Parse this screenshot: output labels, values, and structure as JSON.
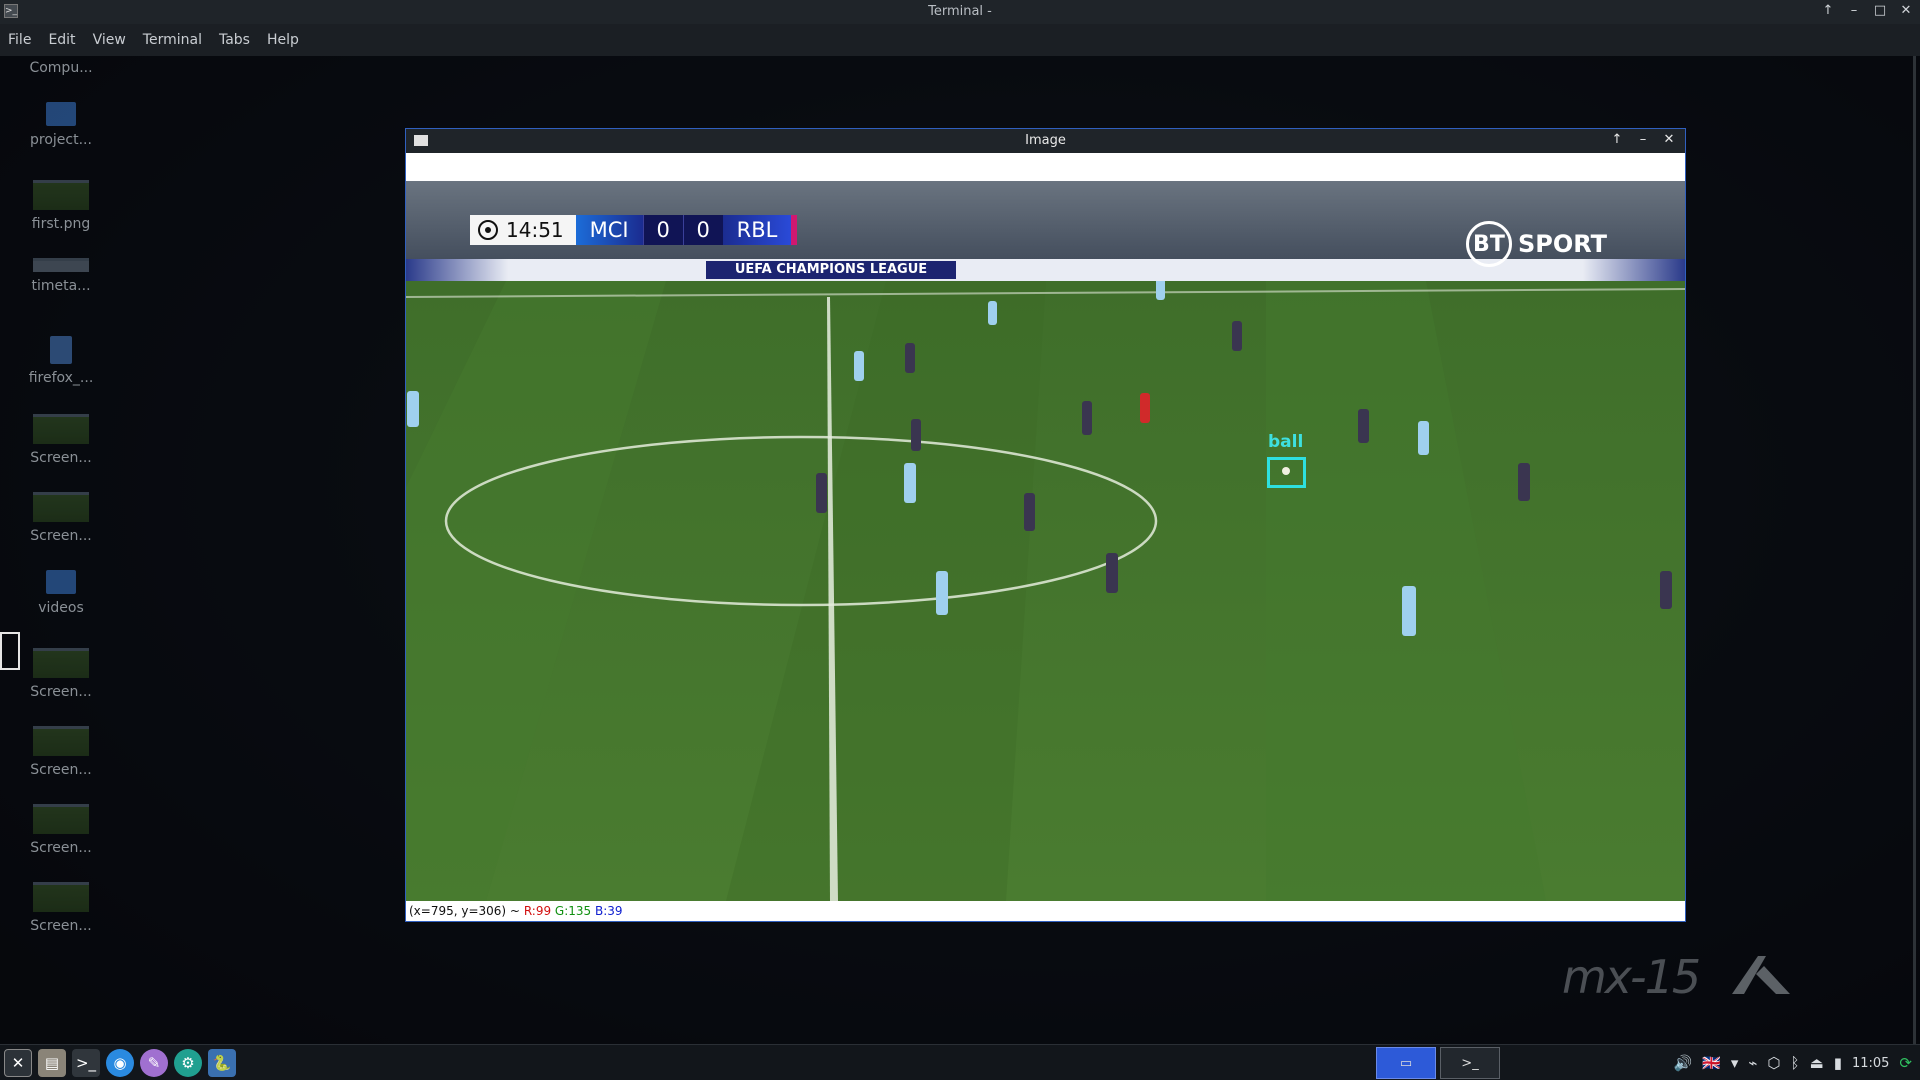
{
  "terminal": {
    "title": "Terminal -",
    "menu": [
      "File",
      "Edit",
      "View",
      "Terminal",
      "Tabs",
      "Help"
    ]
  },
  "desktop_icons": [
    {
      "label": "Compu...",
      "kind": "computer"
    },
    {
      "label": "project...",
      "kind": "folder"
    },
    {
      "label": "first.png",
      "kind": "image"
    },
    {
      "label": "timeta...",
      "kind": "image"
    },
    {
      "label": "firefox_...",
      "kind": "file"
    },
    {
      "label": "Screen...",
      "kind": "image"
    },
    {
      "label": "Screen...",
      "kind": "image"
    },
    {
      "label": "videos",
      "kind": "folder"
    },
    {
      "label": "Screen...",
      "kind": "image"
    },
    {
      "label": "Screen...",
      "kind": "image"
    },
    {
      "label": "Screen...",
      "kind": "image"
    },
    {
      "label": "Screen...",
      "kind": "image"
    }
  ],
  "image_window": {
    "title": "Image",
    "status": {
      "coords": "(x=795, y=306) ~",
      "r": "R:99",
      "g": "G:135",
      "b": "B:39"
    }
  },
  "broadcast": {
    "clock": "14:51",
    "home": "MCI",
    "home_score": "0",
    "away_score": "0",
    "away": "RBL",
    "channel": "SPORT",
    "channel_badge": "BT",
    "banner": "UEFA CHAMPIONS LEAGUE",
    "detection_label": "ball",
    "detection_color": "#2ee0e0"
  },
  "watermark": "mx-15",
  "taskbar": {
    "launchers": [
      "mx-logo-icon",
      "files-icon",
      "terminal-icon",
      "browser-icon",
      "paint-icon",
      "settings-icon",
      "python-icon"
    ],
    "tasks": [
      "image-window-task",
      "terminal-task"
    ],
    "time": "11:05"
  }
}
